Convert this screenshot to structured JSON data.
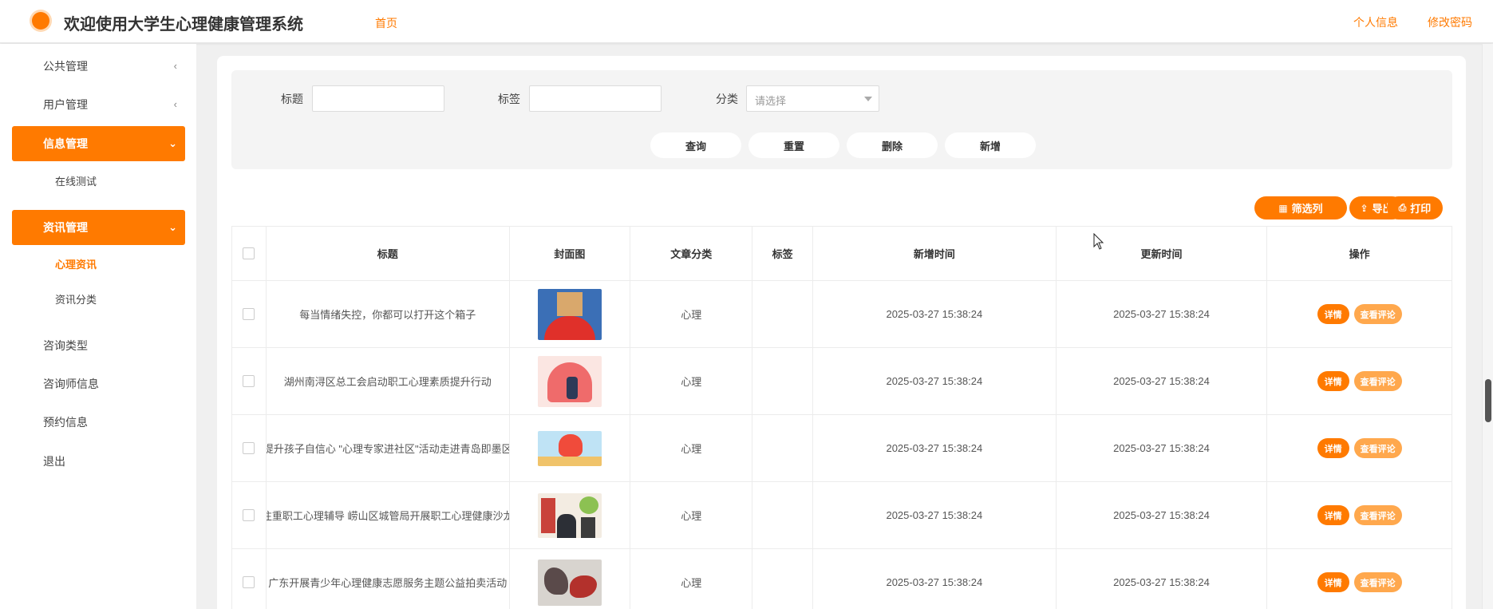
{
  "header": {
    "title": "欢迎使用大学生心理健康管理系统",
    "home": "首页",
    "profile": "个人信息",
    "change_password": "修改密码"
  },
  "sidebar": {
    "items": [
      {
        "label": "公共管理",
        "chevron": "‹"
      },
      {
        "label": "用户管理",
        "chevron": "‹"
      },
      {
        "label": "信息管理",
        "chevron": "⌄"
      },
      {
        "label": "资讯管理",
        "chevron": "⌄"
      },
      {
        "label": "咨询类型"
      },
      {
        "label": "咨询师信息"
      },
      {
        "label": "预约信息"
      },
      {
        "label": "退出"
      }
    ],
    "subs": [
      {
        "label": "在线测试"
      },
      {
        "label": "心理资讯"
      },
      {
        "label": "资讯分类"
      }
    ]
  },
  "filters": {
    "title_label": "标题",
    "tag_label": "标签",
    "category_label": "分类",
    "category_placeholder": "请选择",
    "buttons": {
      "query": "查询",
      "reset": "重置",
      "delete": "删除",
      "add": "新增"
    }
  },
  "toolbar": {
    "filter_cols": "筛选列",
    "export": "导出",
    "print": "打印"
  },
  "table": {
    "headers": [
      "标题",
      "封面图",
      "文章分类",
      "标签",
      "新增时间",
      "更新时间",
      "操作"
    ],
    "rows": [
      {
        "title": "每当情绪失控，你都可以打开这个箱子",
        "category": "心理",
        "tag": "",
        "created": "2025-03-27 15:38:24",
        "updated": "2025-03-27 15:38:24"
      },
      {
        "title": "湖州南浔区总工会启动职工心理素质提升行动",
        "category": "心理",
        "tag": "",
        "created": "2025-03-27 15:38:24",
        "updated": "2025-03-27 15:38:24"
      },
      {
        "title": "提升孩子自信心 \"心理专家进社区\"活动走进青岛即墨区",
        "category": "心理",
        "tag": "",
        "created": "2025-03-27 15:38:24",
        "updated": "2025-03-27 15:38:24"
      },
      {
        "title": "注重职工心理辅导 崂山区城管局开展职工心理健康沙龙",
        "category": "心理",
        "tag": "",
        "created": "2025-03-27 15:38:24",
        "updated": "2025-03-27 15:38:24"
      },
      {
        "title": "广东开展青少年心理健康志愿服务主题公益拍卖活动",
        "category": "心理",
        "tag": "",
        "created": "2025-03-27 15:38:24",
        "updated": "2025-03-27 15:38:24"
      }
    ],
    "actions": {
      "detail": "详情",
      "comments": "查看评论"
    }
  },
  "colors": {
    "accent": "#ff7a00",
    "accent_light": "#ffa84d"
  }
}
